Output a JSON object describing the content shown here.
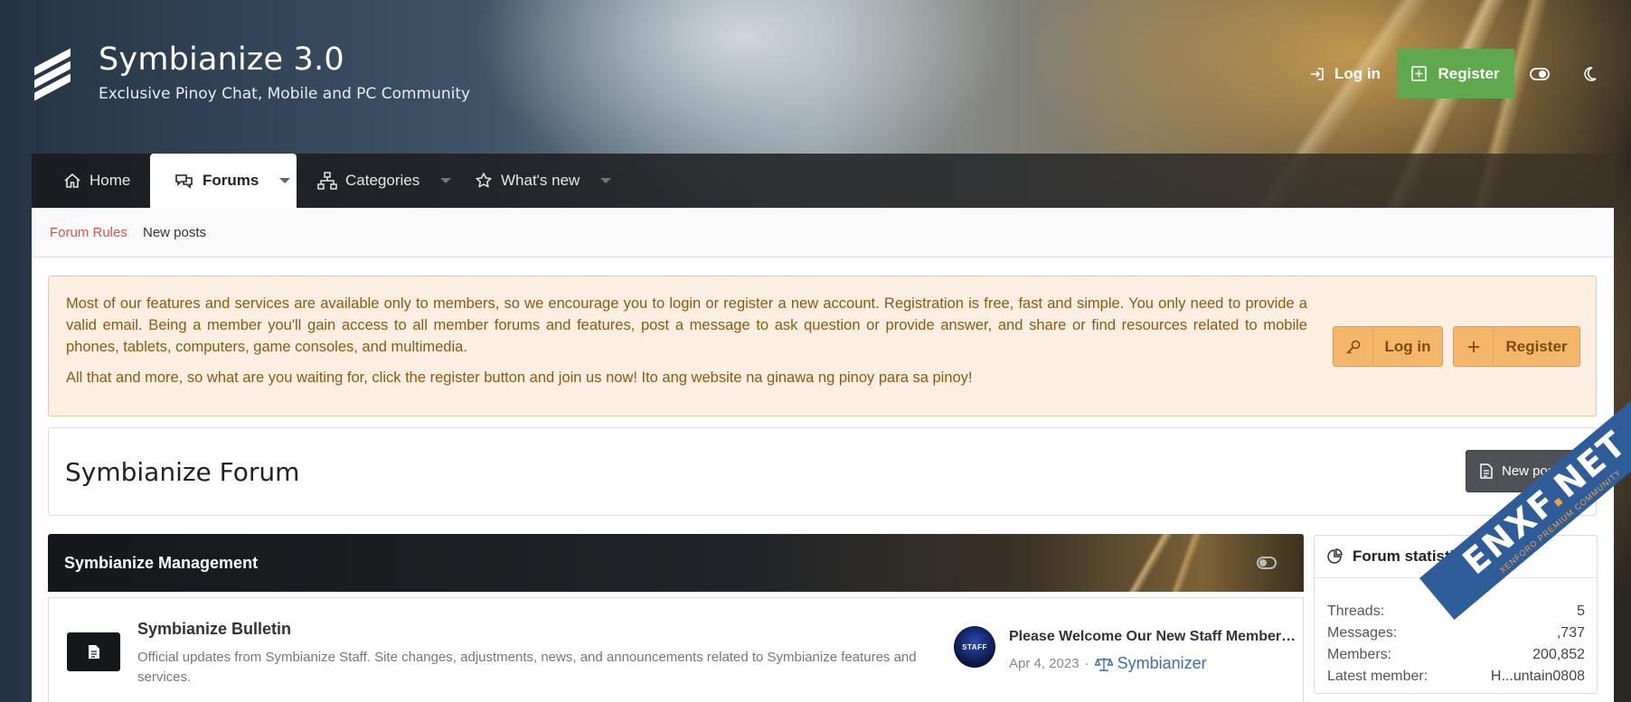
{
  "header": {
    "site_title": "Symbianize 3.0",
    "site_subtitle": "Exclusive Pinoy Chat, Mobile and PC Community",
    "login_label": "Log in",
    "register_label": "Register",
    "register_color": "#5fa84e"
  },
  "nav": {
    "items": [
      {
        "label": "Home",
        "icon": "home-icon"
      },
      {
        "label": "Forums",
        "icon": "chat-bubbles-icon",
        "active": true
      },
      {
        "label": "Categories",
        "icon": "sitemap-icon"
      },
      {
        "label": "What's new",
        "icon": "star-icon"
      }
    ]
  },
  "subnav": {
    "forum_rules": "Forum Rules",
    "new_posts": "New posts"
  },
  "notice": {
    "paragraph1": "Most of our features and services are available only to members, so we encourage you to login or register a new account. Registration is free, fast and simple. You only need to provide a valid email. Being a member you'll gain access to all member forums and features, post a message to ask question or provide answer, and share or find resources related to mobile phones, tablets, computers, game consoles, and multimedia.",
    "paragraph2": "All that and more, so what are you waiting for, click the register button and join us now! Ito ang website na ginawa ng pinoy para sa pinoy!",
    "login_label": "Log in",
    "register_label": "Register"
  },
  "forum": {
    "title": "Symbianize Forum",
    "new_posts_button": "New posts"
  },
  "category": {
    "title": "Symbianize Management",
    "nodes": [
      {
        "title": "Symbianize Bulletin",
        "description": "Official updates from Symbianize Staff. Site changes, adjustments, news, and announcements related to Symbianize features and services.",
        "avatar_text": "STAFF",
        "latest_title": "Please Welcome Our New Staff Member -...",
        "latest_date": "Apr 4, 2023",
        "latest_user": "Symbianizer"
      }
    ]
  },
  "stats": {
    "title": "Forum statistics",
    "rows": [
      {
        "label": "Threads:",
        "value": "5"
      },
      {
        "label": "Messages:",
        "value": ",737"
      },
      {
        "label": "Members:",
        "value": "200,852"
      },
      {
        "label": "Latest member:",
        "value": "H...untain0808"
      }
    ]
  },
  "watermark": {
    "main_left": "ENXF",
    "main_dot": ".",
    "main_right": "NET",
    "sub": "XENFORO PREMIUM COMMUNITY"
  }
}
